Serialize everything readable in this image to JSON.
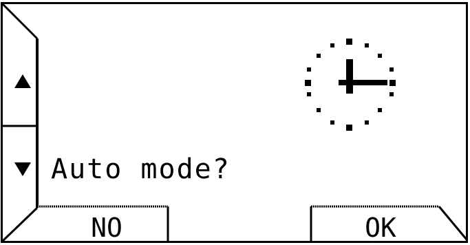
{
  "screen": {
    "prompt": "Auto mode?",
    "icon": "clock-icon",
    "colors": {
      "background": "#ffffff",
      "foreground": "#000000"
    }
  },
  "side_buttons": {
    "up_icon": "arrow-up-icon",
    "down_icon": "arrow-down-icon"
  },
  "softkeys": {
    "left_label": "NO",
    "right_label": "OK"
  }
}
